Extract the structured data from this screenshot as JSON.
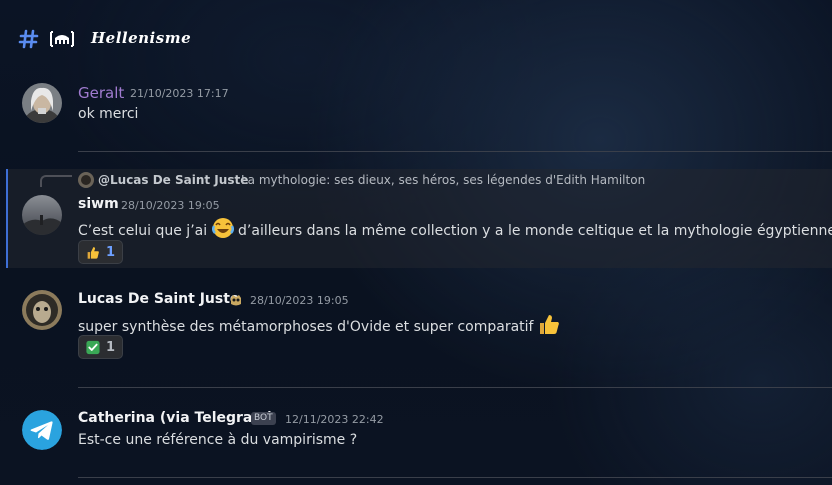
{
  "channel": {
    "icon": "hashtag-icon",
    "emoji": "building-emoji",
    "name": "Hellenisme"
  },
  "messages": [
    {
      "author": "Geralt",
      "author_color": "#a07bd0",
      "timestamp": "21/10/2023 17:17",
      "text": "ok merci"
    },
    {
      "reply_to": {
        "author": "@Lucas De Saint Juste",
        "text": "La mythologie: ses dieux, ses héros, ses légendes d'Edith Hamilton"
      },
      "author": "siwm",
      "timestamp": "28/10/2023 19:05",
      "text_before_emoji": "C’est celui que j’ai",
      "text_emoji": "joy-emoji",
      "text_after_emoji": "d’ailleurs dans la même collection y a le monde celtique et la mythologie égyptienne",
      "reaction": {
        "emoji": "thumbs-up-emoji",
        "count": "1"
      },
      "highlighted": true
    },
    {
      "author": "Lucas De Saint Juste",
      "timestamp": "28/10/2023 19:05",
      "badge": "owl-badge",
      "text": "super synthèse des métamorphoses d'Ovide et super comparatif",
      "text_emoji": "thumbs-up-emoji",
      "reaction": {
        "emoji": "check-mark-emoji",
        "count": "1"
      }
    },
    {
      "author": "Catherina (via Telegram)",
      "tag": "BOT",
      "timestamp": "12/11/2023 22:42",
      "text": "Est-ce une référence à du vampirisme ?",
      "avatar": "telegram-icon",
      "avatar_color": "#2aa3df"
    }
  ]
}
